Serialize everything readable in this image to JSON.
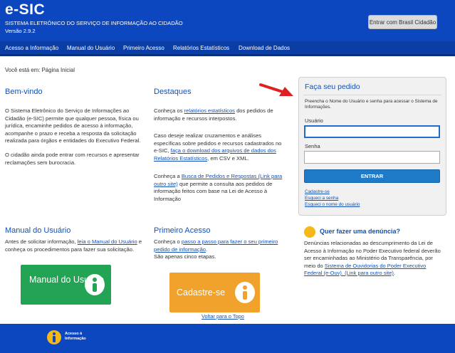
{
  "header": {
    "logo": "e-SIC",
    "subtitle": "SISTEMA ELETRÔNICO DO SERVIÇO DE INFORMAÇÃO AO CIDADÃO",
    "version": "Versão 2.9.2",
    "gov_login_button": "Entrar com Brasil Cidadão"
  },
  "nav": {
    "items": [
      "Acesso a Informação",
      "Manual do Usuário",
      "Primeiro Acesso",
      "Relatórios Estatísticos",
      "Download de Dados"
    ]
  },
  "breadcrumb": "Você está em: Página Inicial",
  "bemvindo": {
    "title": "Bem-vindo",
    "p1": "O Sistema Eletrônico do Serviço de Informações ao Cidadão (e-SIC) permite que qualquer pessoa, física ou jurídica, encaminhe pedidos de acesso à informação, acompanhe o prazo e receba a resposta da solicitação realizada para órgãos e entidades do Executivo Federal.",
    "p2": "O cidadão ainda pode entrar com recursos e apresentar reclamações sem burocracia."
  },
  "destaques": {
    "title": "Destaques",
    "p1_pre": "Conheça os ",
    "p1_link": "relatórios estatísticos",
    "p1_post": " dos pedidos de informação e recursos interpostos.",
    "p2_pre": "Caso deseje realizar cruzamentos e análises específicas sobre pedidos e recursos cadastrados no e-SIC, ",
    "p2_link": "faça o download dos arquivos de dados dos Relatórios Estatísticos",
    "p2_post": ", em CSV e XML.",
    "p3_pre": "Conheça a ",
    "p3_link": "Busca de Pedidos e Respostas (Link para outro site)",
    "p3_post": " que permite a consulta aos pedidos de informação feitos com base na Lei de Acesso à Informação"
  },
  "login": {
    "title": "Faça seu pedido",
    "instructions": "Preencha o Nome do Usuário e senha para acessar o Sistema de Informações.",
    "user_label": "Usuário",
    "user_value": "",
    "password_label": "Senha",
    "password_value": "",
    "submit": "ENTRAR",
    "links": [
      "Cadastre-se",
      "Esqueci a senha",
      "Esqueci o nome do usuário"
    ]
  },
  "manual": {
    "title": "Manual do Usuário",
    "text_pre": "Antes de solicitar informação, ",
    "text_link": "leia o Manual do Usuário",
    "text_post": " e conheça os procedimentos para fazer sua solicitação.",
    "banner": "Manual do Usuário"
  },
  "primeiro": {
    "title": "Primeiro Acesso",
    "text_pre": "Conheça o ",
    "text_link": "passo a passo para fazer o seu primeiro pedido de informação",
    "text_post": ".",
    "text2": "São apenas cinco etapas.",
    "banner": "Cadastre-se"
  },
  "denuncia": {
    "title": "Quer fazer uma denúncia?",
    "text_pre": "Denúncias relacionadas ao descumprimento da Lei de Acesso à Informação no Poder Executivo federal deverão ser encaminhadas ao Ministério da Transparência, por meio do ",
    "text_link": "Sistema de Ouvidorias do Poder Executivo Federal (e-Ouv). (Link para outro site)",
    "text_post": "."
  },
  "back_to_top": "Voltar para o Topo",
  "footer": {
    "brand_line1": "Acesso à",
    "brand_line2": "Informação"
  },
  "colors": {
    "header_blue": "#0d47c0",
    "nav_blue": "#0b3da6",
    "link_blue": "#1351b4",
    "button_blue": "#1f7ac8",
    "arrow_red": "#e02020",
    "banner_green": "#23a455",
    "banner_orange": "#f0a22c",
    "info_yellow": "#f5b818"
  }
}
